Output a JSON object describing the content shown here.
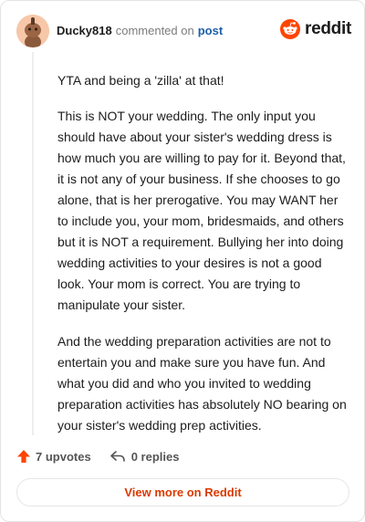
{
  "header": {
    "author": "Ducky818",
    "action": "commented on",
    "post_link": "post",
    "brand": "reddit"
  },
  "comment": {
    "paragraphs": [
      "YTA and being a 'zilla' at that!",
      "This is NOT your wedding. The only input you should have about your sister's wedding dress is how much you are willing to pay for it. Beyond that, it is not any of your business. If she chooses to go alone, that is her prerogative. You may WANT her to include you, your mom, bridesmaids, and others but it is NOT a requirement. Bullying her into doing wedding activities to your desires is not a good look. Your mom is correct. You are trying to manipulate your sister.",
      "And the wedding preparation activities are not to entertain you and make sure you have fun. And what you did and who you invited to wedding preparation activities has absolutely NO bearing on your sister's wedding prep activities."
    ]
  },
  "footer": {
    "upvotes": "7 upvotes",
    "replies": "0 replies"
  },
  "view_more": "View more on Reddit",
  "colors": {
    "accent": "#d93a00",
    "upvote": "#ff4500",
    "link": "#1d5fa8"
  },
  "icons": {
    "avatar": "snoo-avatar",
    "logo": "reddit-logo-icon",
    "upvote": "upvote-arrow-icon",
    "reply": "reply-arrow-icon"
  }
}
